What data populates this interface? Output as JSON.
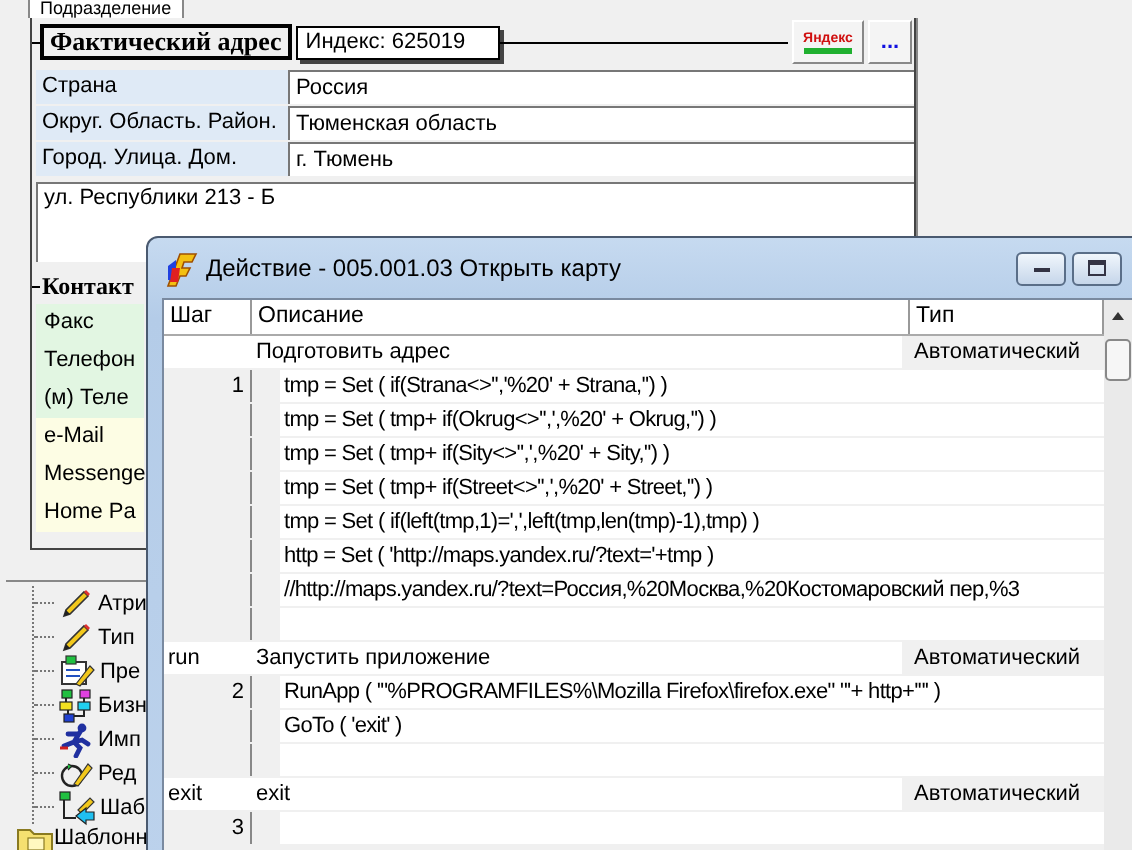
{
  "background_tab": {
    "label": "Подразделение"
  },
  "address": {
    "title": "Фактический адрес",
    "index": "Индекс: 625019",
    "map_button": "Яндекс",
    "more_button": "...",
    "fields": [
      {
        "label": "Страна",
        "value": "Россия"
      },
      {
        "label": "Округ. Область. Район.",
        "value": "Тюменская область"
      },
      {
        "label": "Город. Улица. Дом.",
        "value": "г. Тюмень"
      }
    ],
    "street": "ул. Республики 213 - Б"
  },
  "contacts": {
    "title": "Контакт",
    "fields": [
      {
        "label": "Факс",
        "color": "#e2f6e2"
      },
      {
        "label": "Телефон",
        "color": "#e2f6e2"
      },
      {
        "label": "(м) Теле",
        "color": "#e2f6e2"
      },
      {
        "label": "e-Mail",
        "color": "#fdfde4"
      },
      {
        "label": "Messenge",
        "color": "#fdfde4"
      },
      {
        "label": "Home Pa",
        "color": "#fdfde4"
      }
    ]
  },
  "tree": [
    {
      "children": [
        {
          "label": "Атри",
          "kind": "pencil"
        },
        {
          "label": "Тип",
          "kind": "pencil"
        },
        {
          "label": "Пре",
          "kind": "form"
        },
        {
          "label": "Бизн",
          "kind": "flow"
        },
        {
          "label": "Имп",
          "kind": "runner"
        },
        {
          "label": "Ред",
          "kind": "edit"
        },
        {
          "label": "Шаб",
          "kind": "template"
        }
      ]
    },
    {
      "label": "Шаблонн",
      "kind": "folder"
    }
  ],
  "dialog": {
    "title": "Действие - 005.001.03 Открыть карту",
    "columns": [
      "Шаг",
      "Описание",
      "Тип"
    ],
    "rows": [
      {
        "kind": "group",
        "description": "Подготовить адрес",
        "type": "Автоматический"
      },
      {
        "kind": "code",
        "number": "1",
        "text": "tmp = Set ( if(Strana<>'','%20' + Strana,'') )"
      },
      {
        "kind": "code",
        "text": "tmp = Set ( tmp+ if(Okrug<>'',',%20' + Okrug,'') )"
      },
      {
        "kind": "code",
        "text": "tmp = Set ( tmp+ if(Sity<>'',',%20' + Sity,'') )"
      },
      {
        "kind": "code",
        "text": "tmp = Set ( tmp+ if(Street<>'',',%20' + Street,'') )"
      },
      {
        "kind": "code",
        "text": "tmp = Set ( if(left(tmp,1)=',',left(tmp,len(tmp)-1),tmp) )"
      },
      {
        "kind": "code",
        "text": "http = Set ( 'http://maps.yandex.ru/?text='+tmp )"
      },
      {
        "kind": "code",
        "text": "//http://maps.yandex.ru/?text=Россия,%20Москва,%20Костомаровский пер,%3"
      },
      {
        "kind": "blank"
      },
      {
        "kind": "group",
        "step": "run",
        "description": "Запустить приложение",
        "type": "Автоматический"
      },
      {
        "kind": "code",
        "number": "2",
        "text": "RunApp ( '\"%PROGRAMFILES%\\Mozilla Firefox\\firefox.exe\" \"'+ http+'\"' )"
      },
      {
        "kind": "code",
        "text": "GoTo ( 'exit' )"
      },
      {
        "kind": "blank"
      },
      {
        "kind": "group",
        "step": "exit",
        "description": "exit",
        "type": "Автоматический"
      },
      {
        "kind": "code",
        "number": "3"
      }
    ]
  }
}
